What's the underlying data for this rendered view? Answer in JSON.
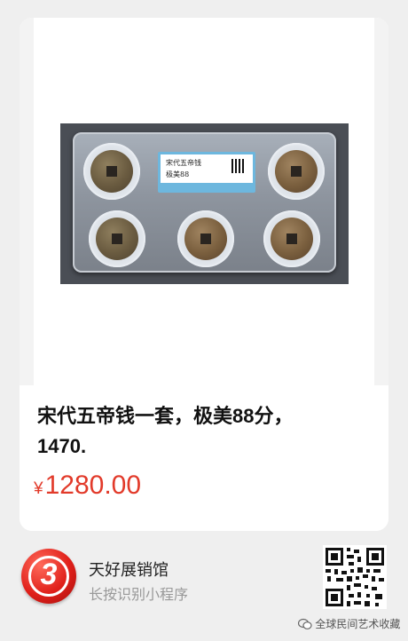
{
  "product": {
    "title_line1": "宋代五帝钱一套，极美88分，",
    "title_line2": "1470.",
    "price_currency": "¥",
    "price_value": "1280.00",
    "image": {
      "label_line1": "宋代五帝钱",
      "label_line2": "极美88"
    }
  },
  "shop": {
    "logo_text": "3",
    "name": "天好展销馆",
    "hint": "长按识别小程序"
  },
  "watermark": {
    "text": "全球民间艺术收藏"
  },
  "colors": {
    "price": "#e23a2a",
    "logo": "#e0201a",
    "background": "#efefef"
  }
}
